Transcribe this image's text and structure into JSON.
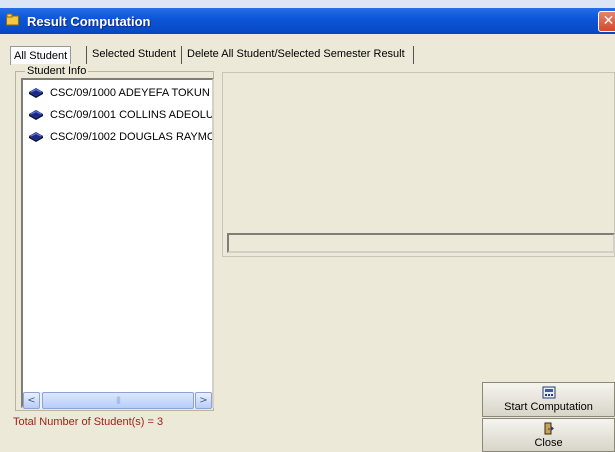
{
  "window": {
    "title": "Result Computation",
    "close_glyph": "✕",
    "icon": "folder-icon"
  },
  "tabs": [
    {
      "label": "All Student",
      "active": true
    },
    {
      "label": "Selected Student",
      "active": false
    },
    {
      "label": "Delete All Student/Selected Semester Result",
      "active": false
    }
  ],
  "student_info": {
    "legend": "Student Info",
    "item_icon": "book-icon",
    "items": [
      {
        "label": "CSC/09/1000  ADEYEFA  TOKUN"
      },
      {
        "label": "CSC/09/1001  COLLINS  ADEOLU"
      },
      {
        "label": "CSC/09/1002  DOUGLAS  RAYMC"
      }
    ]
  },
  "scrollbar": {
    "left_glyph": "<",
    "right_glyph": ">",
    "grip": "|||"
  },
  "progress": {
    "value": 0
  },
  "status": {
    "text": "Total Number of Student(s) = 3"
  },
  "buttons": {
    "start_label": "Start Computation",
    "close_label": "Close"
  },
  "colors": {
    "title_bar": "#0a5bd8",
    "status_text": "#a0231a",
    "background": "#ece9d8"
  }
}
